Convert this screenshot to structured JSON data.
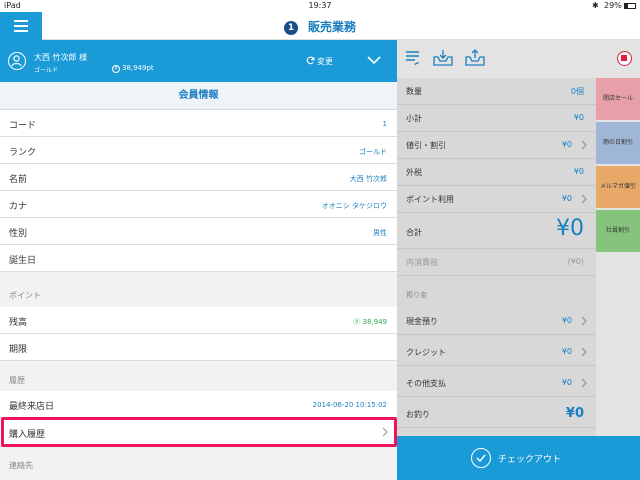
{
  "status": {
    "carrier": "iPad",
    "time": "19:37",
    "bluetooth": "✱",
    "battery": "29%"
  },
  "nav": {
    "badge": "1",
    "title": "販売業務"
  },
  "member": {
    "name": "大西 竹次郎 様",
    "rank": "ゴールド",
    "points": "38,949pt",
    "point_icon": "P",
    "change_label": "変更"
  },
  "member_info": {
    "title": "会員情報",
    "rows": [
      {
        "label": "コード",
        "value": "1"
      },
      {
        "label": "ランク",
        "value": "ゴールド"
      },
      {
        "label": "名前",
        "value": "大西 竹次郎"
      },
      {
        "label": "カナ",
        "value": "オオニシ タケジロウ"
      },
      {
        "label": "性別",
        "value": "男性"
      },
      {
        "label": "誕生日",
        "value": ""
      }
    ],
    "points_group": "ポイント",
    "points_rows": [
      {
        "label": "残高",
        "value": "ⓟ 38,949"
      },
      {
        "label": "期限",
        "value": ""
      }
    ],
    "history_group": "履歴",
    "history_rows": [
      {
        "label": "最終来店日",
        "value": "2014-06-20 10:15:02"
      },
      {
        "label": "購入履歴",
        "value": ""
      }
    ],
    "contact_group": "連絡先"
  },
  "calc": {
    "qty_label": "数量",
    "qty_value": "0個",
    "subtotal_label": "小計",
    "subtotal_value": "¥0",
    "discount_label": "値引・割引",
    "discount_value": "¥0",
    "tax_label": "外税",
    "tax_value": "¥0",
    "points_label": "ポイント利用",
    "points_value": "¥0",
    "total_label": "合計",
    "total_value": "¥0",
    "inner_tax_label": "内消費税",
    "inner_tax_value": "(¥0)",
    "deposit_group": "預り金",
    "cash_label": "現金預り",
    "cash_value": "¥0",
    "credit_label": "クレジット",
    "credit_value": "¥0",
    "other_label": "その他支払",
    "other_value": "¥0",
    "change_label": "お釣り",
    "change_value": "¥0"
  },
  "discount_buttons": [
    {
      "label": "開店セール",
      "color": "#e8a0a8"
    },
    {
      "label": "雨の日割引",
      "color": "#9fb6d6"
    },
    {
      "label": "メルマガ値引",
      "color": "#e8a868"
    },
    {
      "label": "社員割引",
      "color": "#86c47e"
    }
  ],
  "checkout_label": "チェックアウト",
  "colors": {
    "accent": "#1a9ad6",
    "highlight": "#f0125a"
  }
}
